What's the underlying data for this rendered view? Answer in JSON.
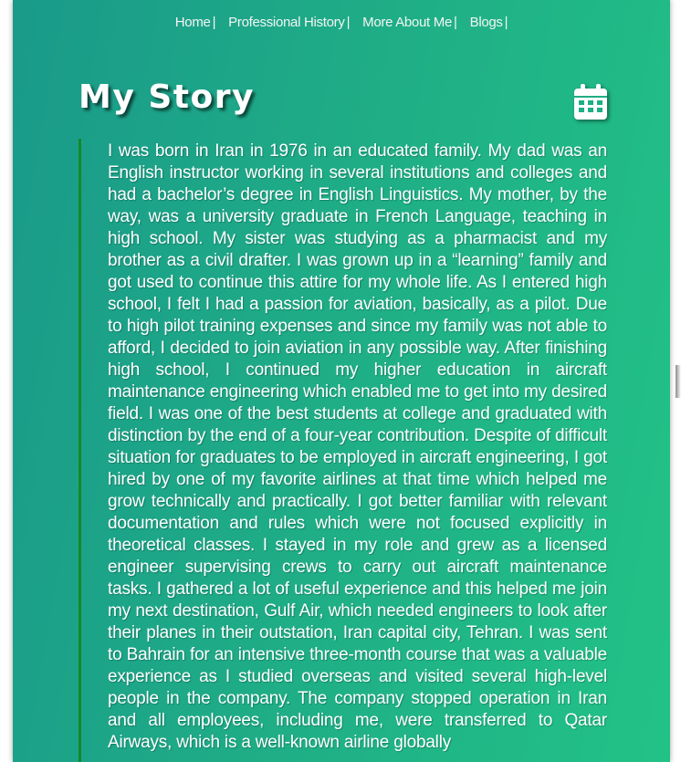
{
  "nav": {
    "items": [
      {
        "label": "Home"
      },
      {
        "label": "Professional History"
      },
      {
        "label": "More About Me"
      },
      {
        "label": "Blogs"
      }
    ],
    "separator": "|"
  },
  "section": {
    "title": "My Story",
    "icon": "calendar-icon"
  },
  "story": {
    "text": "I was born in Iran in 1976 in an educated family. My dad was an English instructor working in several institutions and colleges and had a bachelor’s degree in English Linguistics. My mother, by the way, was a university graduate in French Language, teaching in high school. My sister was studying as a pharmacist and my brother as a civil drafter. I was grown up in a “learning” family and got used to continue this attire for my whole life. As I entered high school, I felt I had a passion for aviation, basically, as a pilot. Due to high pilot training expenses and since my family was not able to afford, I decided to join aviation in any possible way. After finishing high school, I continued my higher education in aircraft maintenance engineering which enabled me to get into my desired field. I was one of the best students at college and graduated with distinction by the end of a four-year contribution. Despite of difficult situation for graduates to be employed in aircraft engineering, I got hired by one of my favorite airlines at that time which helped me grow technically and practically. I got better familiar with relevant documentation and rules which were not focused explicitly in theoretical classes. I stayed in my role and grew as a licensed engineer supervising crews to carry out aircraft maintenance tasks. I gathered a lot of useful experience and this helped me join my next destination, Gulf Air, which needed engineers to look after their planes in their outstation, Iran capital city, Tehran. I was sent to Bahrain for an intensive three-month course that was a valuable experience as I studied overseas and visited several high-level people in the company. The company stopped operation in Iran and all employees, including me, were transferred to Qatar Airways, which is a well-known airline globally"
  },
  "colors": {
    "gradient_start": "#1a9a8a",
    "gradient_end": "#22c287",
    "accent_border": "#138a2a",
    "text": "#ffffff"
  }
}
